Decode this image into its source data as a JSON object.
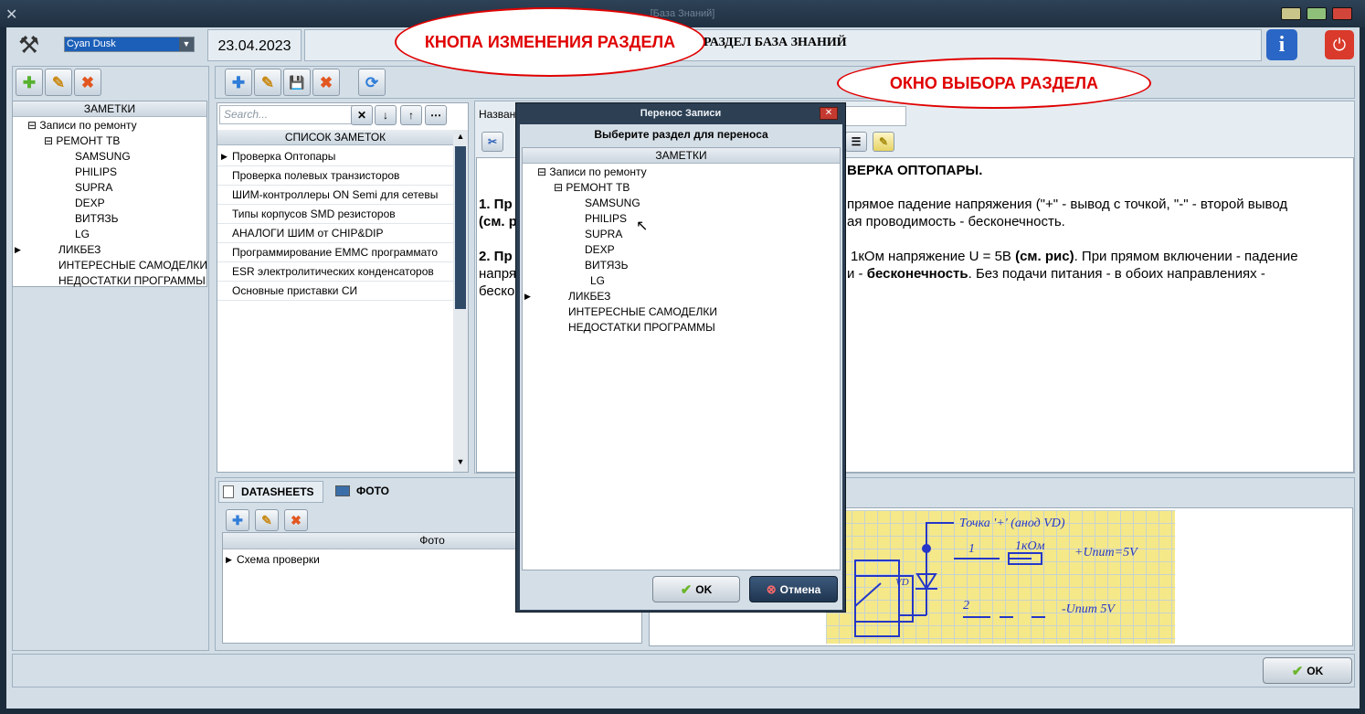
{
  "window": {
    "title": "[База Знаний]"
  },
  "header": {
    "theme": "Cyan Dusk",
    "date": "23.04.2023",
    "section_title": "РАЗДЕЛ БАЗА ЗНАНИЙ"
  },
  "callouts": {
    "edit_button": "КНОПА ИЗМЕНЕНИЯ РАЗДЕЛА",
    "choose_window": "ОКНО ВЫБОРА РАЗДЕЛА"
  },
  "left_tree": {
    "header": "ЗАМЕТКИ",
    "root": "Записи по ремонту",
    "group": "РЕМОНТ ТВ",
    "items": [
      "SAMSUNG",
      "PHILIPS",
      "SUPRA",
      "DEXP",
      "ВИТЯЗЬ",
      "LG"
    ],
    "others": [
      "ЛИКБЕЗ",
      "ИНТЕРЕСНЫЕ САМОДЕЛКИ",
      "НЕДОСТАТКИ ПРОГРАММЫ"
    ]
  },
  "notes": {
    "search_placeholder": "Search...",
    "header": "СПИСОК ЗАМЕТОК",
    "items": [
      "Проверка Оптопары",
      "Проверка полевых транзисторов",
      "ШИМ-контроллеры ON Semi для сетевы",
      "Типы корпусов SMD резисторов",
      "АНАЛОГИ ШИМ от CHIP&DIP",
      "Программирование EMMC программато",
      "ESR электролитических конденсаторов",
      "Основные приставки СИ"
    ]
  },
  "editor": {
    "name_label": "Назван",
    "heading": "ВЕРКА ОПТОПАРЫ.",
    "p1_a": "1. Пр",
    "p1_b": "прямое падение напряжения (\"+\" - вывод с точкой, \"-\" - второй вывод",
    "p1_c": "(см. р",
    "p1_d": "ая проводимость - бесконечность.",
    "p2_a": "2. Пр",
    "p2_b": "1кОм напряжение U = 5В",
    "p2_bold": "(см. рис)",
    "p2_c": ". При прямом включении - падение",
    "p2_d": "напря",
    "p2_e": "и -",
    "p2_bold2": "бесконечность",
    "p2_f": ". Без подачи питания - в обоих направлениях -",
    "p2_g": "беско"
  },
  "tabs": {
    "datasheets": "DATASHEETS",
    "foto": "ФОТО"
  },
  "photo": {
    "header": "Фото",
    "items": [
      "Схема проверки"
    ]
  },
  "sketch": {
    "l1": "Точка '+' (анод VD)",
    "l2": "1",
    "l3": "1кОм",
    "l4": "+Uпит=5V",
    "l5": "2",
    "l6": "-Uпит 5V",
    "l7": "VD"
  },
  "dialog": {
    "title": "Перенос Записи",
    "subtitle": "Выберите раздел для переноса",
    "header": "ЗАМЕТКИ",
    "ok": "OK",
    "cancel": "Отмена"
  },
  "footer": {
    "ok": "OK"
  }
}
